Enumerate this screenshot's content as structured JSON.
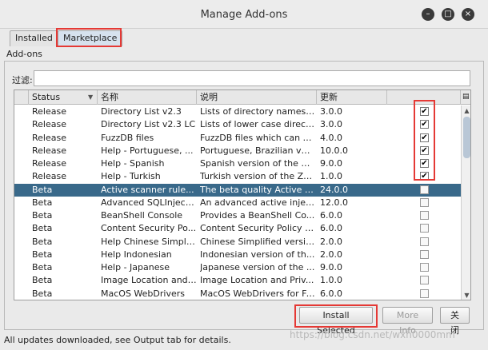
{
  "window": {
    "title": "Manage Add-ons"
  },
  "tabs": [
    {
      "label": "Installed",
      "active": false
    },
    {
      "label": "Marketplace",
      "active": true
    }
  ],
  "section_label": "Add-ons",
  "filter": {
    "label": "过滤:",
    "value": ""
  },
  "table": {
    "columns": [
      "Status",
      "名称",
      "说明",
      "更新"
    ],
    "sort_indicator": "▼",
    "corner_icon": "column-chooser-icon",
    "rows": [
      {
        "status": "Release",
        "name": "Directory List v2.3",
        "desc": "Lists of directory names ...",
        "version": "3.0.0",
        "checked": true
      },
      {
        "status": "Release",
        "name": "Directory List v2.3 LC",
        "desc": "Lists of lower case direct...",
        "version": "3.0.0",
        "checked": true
      },
      {
        "status": "Release",
        "name": "FuzzDB files",
        "desc": "FuzzDB files which can be...",
        "version": "4.0.0",
        "checked": true
      },
      {
        "status": "Release",
        "name": "Help - Portuguese, ...",
        "desc": "Portuguese, Brazilian ver...",
        "version": "10.0.0",
        "checked": true
      },
      {
        "status": "Release",
        "name": "Help - Spanish",
        "desc": "Spanish version of the Z...",
        "version": "9.0.0",
        "checked": true
      },
      {
        "status": "Release",
        "name": "Help - Turkish",
        "desc": "Turkish version of the ZA...",
        "version": "1.0.0",
        "checked": true
      },
      {
        "status": "Beta",
        "name": "Active scanner rule...",
        "desc": "The beta quality Active S...",
        "version": "24.0.0",
        "checked": false,
        "selected": true
      },
      {
        "status": "Beta",
        "name": "Advanced SQLInjecti...",
        "desc": "An advanced active injec...",
        "version": "12.0.0",
        "checked": false
      },
      {
        "status": "Beta",
        "name": "BeanShell Console",
        "desc": "Provides a BeanShell Co...",
        "version": "6.0.0",
        "checked": false
      },
      {
        "status": "Beta",
        "name": "Content Security Po...",
        "desc": "Content Security Policy (...",
        "version": "6.0.0",
        "checked": false
      },
      {
        "status": "Beta",
        "name": "Help Chinese Simplif...",
        "desc": "Chinese Simplified versio...",
        "version": "2.0.0",
        "checked": false
      },
      {
        "status": "Beta",
        "name": "Help Indonesian",
        "desc": "Indonesian version of th...",
        "version": "2.0.0",
        "checked": false
      },
      {
        "status": "Beta",
        "name": "Help - Japanese",
        "desc": "Japanese version of the ...",
        "version": "9.0.0",
        "checked": false
      },
      {
        "status": "Beta",
        "name": "Image Location and ...",
        "desc": "Image Location and Priv...",
        "version": "1.0.0",
        "checked": false
      },
      {
        "status": "Beta",
        "name": "MacOS WebDrivers",
        "desc": "MacOS WebDrivers for Fir...",
        "version": "6.0.0",
        "checked": false
      }
    ]
  },
  "buttons": {
    "install": "Install Selected",
    "more_info": "More Info",
    "close": "关闭"
  },
  "status_bar": "All updates downloaded, see Output tab for details.",
  "watermark": "https://blog.csdn.net/wxh0000mm",
  "colors": {
    "selected_row": "#39698a",
    "highlight": "#e53935"
  }
}
